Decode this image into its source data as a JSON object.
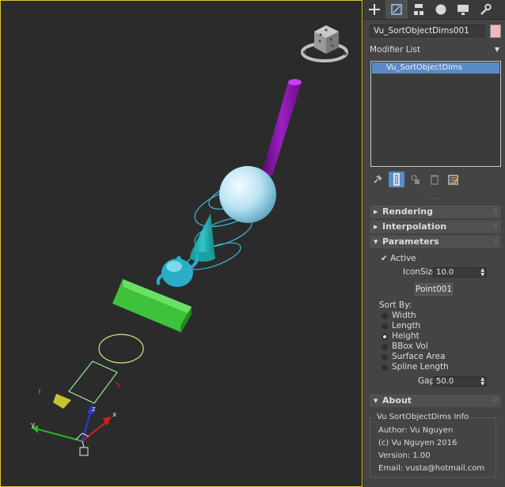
{
  "command_panel": {
    "tabs": [
      {
        "icon": "plus-icon",
        "active": false
      },
      {
        "icon": "modify-icon",
        "active": true
      },
      {
        "icon": "hierarchy-icon",
        "active": false
      },
      {
        "icon": "motion-icon",
        "active": false
      },
      {
        "icon": "display-icon",
        "active": false
      },
      {
        "icon": "wrench-icon",
        "active": false
      }
    ],
    "object_name": "Vu_SortObjectDims001",
    "object_color": "#f2b7b7",
    "modifier_list_label": "Modifier List",
    "stack_item": "Vu_SortObjectDims",
    "grip": "····"
  },
  "rollouts": {
    "rendering": "Rendering",
    "interpolation": "Interpolation",
    "parameters": "Parameters",
    "about": "About"
  },
  "parameters": {
    "active_label": "Active",
    "active_checked": true,
    "iconsize_label": "IconSize",
    "iconsize_value": "10.0",
    "pick_button": "Point001",
    "sort_by_label": "Sort By:",
    "sort_options": [
      "Width",
      "Length",
      "Height",
      "BBox Vol",
      "Surface Area",
      "Spline Length"
    ],
    "sort_selected": "Height",
    "gap_label": "Gap",
    "gap_value": "50.0"
  },
  "about": {
    "group_title": "Vu SortObjectDims Info",
    "author": "Author: Vu Nguyen",
    "copyright": "(c) Vu Nguyen 2016",
    "version": "Version: 1.00",
    "email": "Email: vusta@hotmail.com"
  },
  "viewport": {
    "border_color": "#e0c341",
    "background": "#2b2b2b"
  }
}
